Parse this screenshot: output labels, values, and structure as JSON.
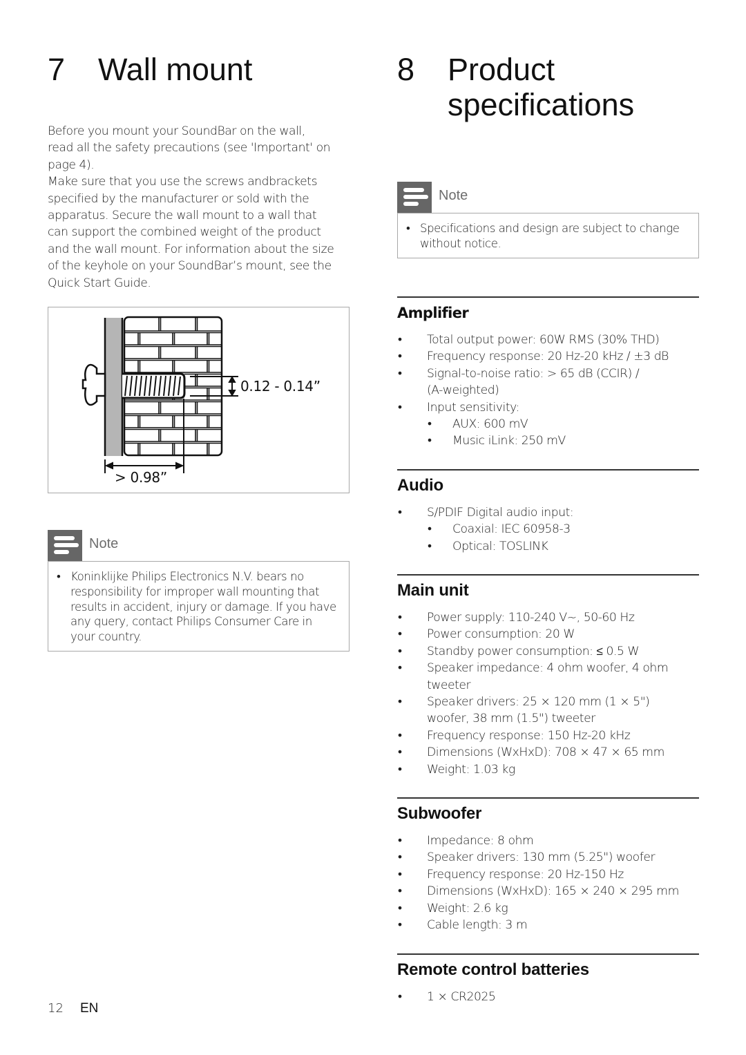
{
  "left_column": {
    "chapter": {
      "number": "7",
      "title": "Wall mount"
    },
    "intro_paragraph_lines": [
      "Before you mount your SoundBar on the wall,",
      "read all the safety precautions (see 'Important' on",
      "page 4).",
      "Make sure that you use the screws andbrackets",
      "specified by the manufacturer or sold with the",
      "apparatus. Secure the wall mount to a wall that",
      "can support the combined weight of the product",
      "and the wall mount. For information about the size",
      "of the keyhole on your SoundBar’s mount, see the",
      "Quick Start Guide."
    ],
    "figure": {
      "screw_diameter_label": "0.12 - 0.14”",
      "screw_depth_label": "> 0.98”"
    },
    "note": {
      "label": "Note",
      "icon": "note-lines-icon",
      "items": [
        {
          "bullet": "•",
          "lines": [
            "Koninklijke Philips Electronics N.V. bears no",
            "responsibility for improper wall mounting that",
            "results in accident, injury or damage. If you have",
            "any query, contact Philips Consumer Care in",
            "your country."
          ]
        }
      ]
    }
  },
  "right_column": {
    "chapter": {
      "number": "8",
      "title_line1": "Product",
      "title_line2": "specifications"
    },
    "note": {
      "label": "Note",
      "icon": "note-lines-icon",
      "items": [
        {
          "bullet": "•",
          "lines": [
            "Specifications and design are subject to change",
            "without notice."
          ]
        }
      ]
    },
    "sections": [
      {
        "title": "Amplifier",
        "items": [
          {
            "bullet": "•",
            "level": 1,
            "lines": [
              "Total output power: 60W RMS (30% THD)"
            ]
          },
          {
            "bullet": "•",
            "level": 1,
            "lines": [
              "Frequency response: 20 Hz-20 kHz / ±3 dB"
            ]
          },
          {
            "bullet": "•",
            "level": 1,
            "lines": [
              "Signal-to-noise ratio: > 65 dB (CCIR) /",
              "(A-weighted)"
            ]
          },
          {
            "bullet": "•",
            "level": 1,
            "lines": [
              "Input sensitivity:"
            ]
          },
          {
            "bullet": "•",
            "level": 2,
            "lines": [
              "AUX: 600 mV"
            ]
          },
          {
            "bullet": "•",
            "level": 2,
            "lines": [
              "Music iLink: 250 mV"
            ]
          }
        ]
      },
      {
        "title": "Audio",
        "items": [
          {
            "bullet": "•",
            "level": 1,
            "lines": [
              "S/PDIF Digital audio input:"
            ]
          },
          {
            "bullet": "•",
            "level": 2,
            "lines": [
              "Coaxial: IEC 60958-3"
            ]
          },
          {
            "bullet": "•",
            "level": 2,
            "lines": [
              "Optical: TOSLINK"
            ]
          }
        ]
      },
      {
        "title": "Main unit",
        "items": [
          {
            "bullet": "•",
            "level": 1,
            "lines": [
              "Power supply: 110-240 V~, 50-60 Hz"
            ]
          },
          {
            "bullet": "•",
            "level": 1,
            "lines": [
              "Power consumption: 20 W"
            ]
          },
          {
            "bullet": "•",
            "level": 1,
            "lines": [
              "Standby power consumption: ≤ 0.5 W"
            ]
          },
          {
            "bullet": "•",
            "level": 1,
            "lines": [
              "Speaker impedance: 4 ohm woofer, 4 ohm",
              "tweeter"
            ]
          },
          {
            "bullet": "•",
            "level": 1,
            "lines": [
              "Speaker drivers: 25 × 120 mm (1 × 5\")",
              "woofer, 38 mm (1.5\") tweeter"
            ]
          },
          {
            "bullet": "•",
            "level": 1,
            "lines": [
              "Frequency response: 150 Hz-20 kHz"
            ]
          },
          {
            "bullet": "•",
            "level": 1,
            "lines": [
              "Dimensions (WxHxD): 708 × 47 × 65 mm"
            ]
          },
          {
            "bullet": "•",
            "level": 1,
            "lines": [
              "Weight: 1.03 kg"
            ]
          }
        ]
      },
      {
        "title": "Subwoofer",
        "items": [
          {
            "bullet": "•",
            "level": 1,
            "lines": [
              "Impedance: 8 ohm"
            ]
          },
          {
            "bullet": "•",
            "level": 1,
            "lines": [
              "Speaker drivers: 130 mm (5.25\") woofer"
            ]
          },
          {
            "bullet": "•",
            "level": 1,
            "lines": [
              "Frequency response: 20 Hz-150 Hz"
            ]
          },
          {
            "bullet": "•",
            "level": 1,
            "lines": [
              "Dimensions (WxHxD): 165 × 240 × 295 mm"
            ]
          },
          {
            "bullet": "•",
            "level": 1,
            "lines": [
              "Weight: 2.6 kg"
            ]
          },
          {
            "bullet": "•",
            "level": 1,
            "lines": [
              "Cable length: 3 m"
            ]
          }
        ]
      },
      {
        "title": "Remote control batteries",
        "items": [
          {
            "bullet": "•",
            "level": 1,
            "lines": [
              "1 × CR2025"
            ]
          }
        ]
      }
    ]
  },
  "footer": {
    "page_number": "12",
    "language": "EN"
  }
}
